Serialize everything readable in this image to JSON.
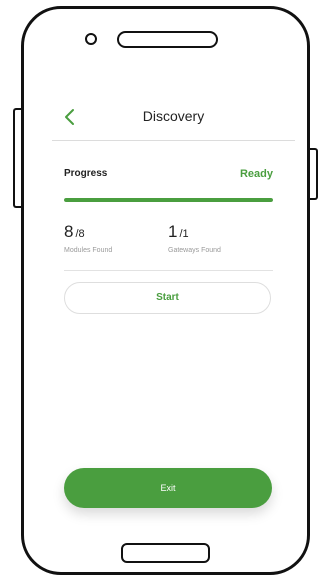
{
  "header": {
    "title": "Discovery",
    "back_icon": "chevron-left-icon"
  },
  "progress": {
    "label": "Progress",
    "status": "Ready",
    "value_percent": 100
  },
  "stats": {
    "modules": {
      "value": "8",
      "total": "/8",
      "caption": "Modules Found"
    },
    "gateways": {
      "value": "1",
      "total": "/1",
      "caption": "Gateways Found"
    }
  },
  "actions": {
    "start_label": "Start",
    "exit_label": "Exit"
  },
  "colors": {
    "accent": "#4a9e3f",
    "text": "#222222",
    "muted": "#9a9a9a"
  }
}
